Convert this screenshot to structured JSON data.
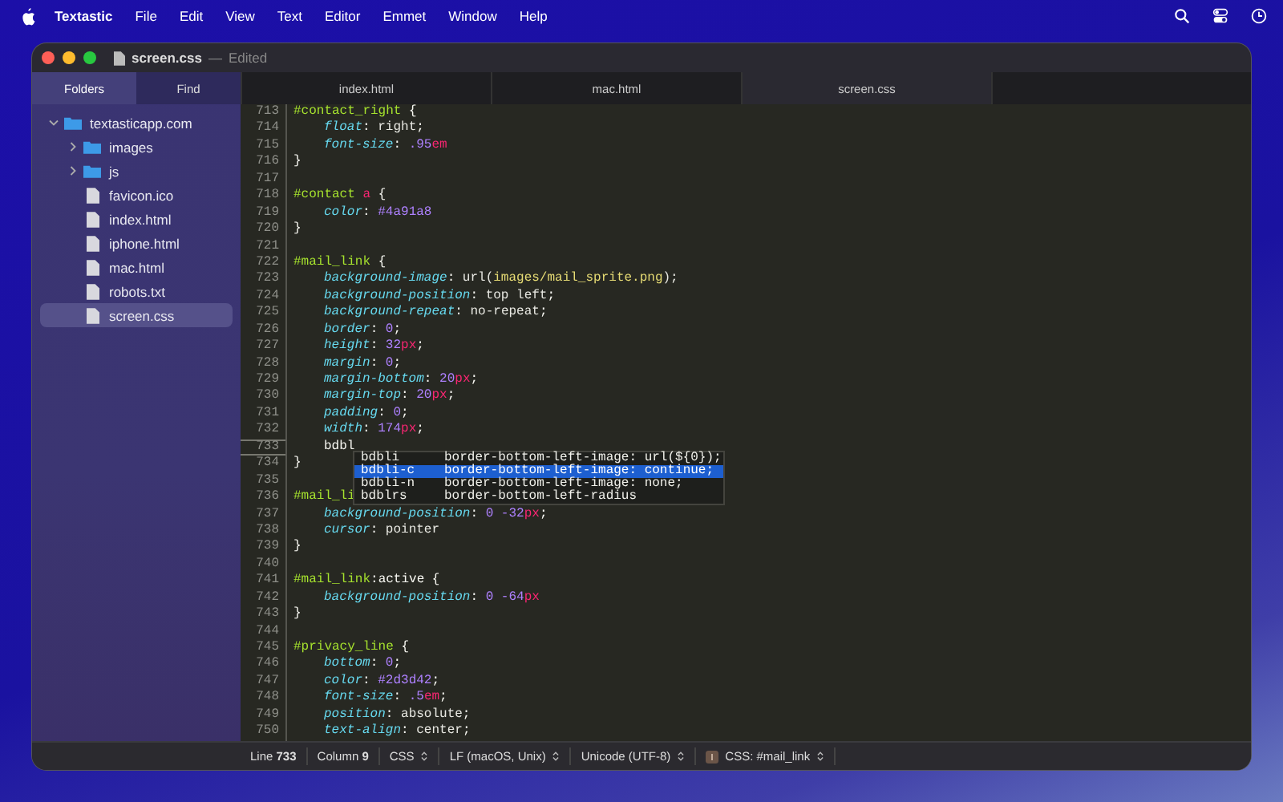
{
  "menubar": {
    "items": [
      {
        "label": "Textastic",
        "kind": "app"
      },
      {
        "label": "File",
        "kind": "menu"
      },
      {
        "label": "Edit",
        "kind": "menu"
      },
      {
        "label": "View",
        "kind": "menu"
      },
      {
        "label": "Text",
        "kind": "menu"
      },
      {
        "label": "Editor",
        "kind": "menu"
      },
      {
        "label": "Emmet",
        "kind": "menu"
      },
      {
        "label": "Window",
        "kind": "menu"
      },
      {
        "label": "Help",
        "kind": "menu"
      }
    ]
  },
  "window": {
    "title": "screen.css",
    "separator": "—",
    "subtitle": "Edited"
  },
  "sidebar": {
    "tabs": [
      {
        "label": "Folders",
        "selected": true
      },
      {
        "label": "Find",
        "selected": false
      }
    ],
    "tree": [
      {
        "name": "textasticapp.com",
        "kind": "folder",
        "expanded": true,
        "selected": false,
        "children": [
          {
            "name": "images",
            "kind": "folder",
            "expanded": false,
            "selected": false
          },
          {
            "name": "js",
            "kind": "folder",
            "expanded": false,
            "selected": false
          },
          {
            "name": "favicon.ico",
            "kind": "file",
            "selected": false
          },
          {
            "name": "index.html",
            "kind": "file",
            "selected": false
          },
          {
            "name": "iphone.html",
            "kind": "file",
            "selected": false
          },
          {
            "name": "mac.html",
            "kind": "file",
            "selected": false
          },
          {
            "name": "robots.txt",
            "kind": "file",
            "selected": false
          },
          {
            "name": "screen.css",
            "kind": "file",
            "selected": true
          }
        ]
      }
    ]
  },
  "tabs": [
    {
      "label": "index.html",
      "selected": false
    },
    {
      "label": "mac.html",
      "selected": false
    },
    {
      "label": "screen.css",
      "selected": true
    }
  ],
  "code": [
    {
      "n": "713",
      "current": false,
      "indent": false,
      "tokens": [
        {
          "kind": "sel",
          "text": "#contact_right"
        },
        {
          "kind": "p",
          "text": " {"
        }
      ]
    },
    {
      "n": "714",
      "current": false,
      "indent": true,
      "tokens": [
        {
          "kind": "prop",
          "text": "float"
        },
        {
          "kind": "p",
          "text": ": "
        },
        {
          "kind": "val",
          "text": "right"
        },
        {
          "kind": "p",
          "text": ";"
        }
      ]
    },
    {
      "n": "715",
      "current": false,
      "indent": true,
      "tokens": [
        {
          "kind": "prop",
          "text": "font-size"
        },
        {
          "kind": "p",
          "text": ": "
        },
        {
          "kind": "num",
          "text": ".95"
        },
        {
          "kind": "unit",
          "text": "em"
        }
      ]
    },
    {
      "n": "716",
      "current": false,
      "indent": false,
      "tokens": [
        {
          "kind": "p",
          "text": "}"
        }
      ]
    },
    {
      "n": "717",
      "current": false
    },
    {
      "n": "718",
      "current": false,
      "indent": false,
      "tokens": [
        {
          "kind": "sel",
          "text": "#contact"
        },
        {
          "kind": "unit",
          "text": " a"
        },
        {
          "kind": "p",
          "text": " {"
        }
      ]
    },
    {
      "n": "719",
      "current": false,
      "indent": true,
      "tokens": [
        {
          "kind": "prop",
          "text": "color"
        },
        {
          "kind": "p",
          "text": ": "
        },
        {
          "kind": "num",
          "text": "#4a91a8"
        }
      ]
    },
    {
      "n": "720",
      "current": false,
      "indent": false,
      "tokens": [
        {
          "kind": "p",
          "text": "}"
        }
      ]
    },
    {
      "n": "721",
      "current": false
    },
    {
      "n": "722",
      "current": false,
      "indent": false,
      "tokens": [
        {
          "kind": "sel",
          "text": "#mail_link"
        },
        {
          "kind": "p",
          "text": " {"
        }
      ]
    },
    {
      "n": "723",
      "current": false,
      "indent": true,
      "tokens": [
        {
          "kind": "prop",
          "text": "background-image"
        },
        {
          "kind": "p",
          "text": ": "
        },
        {
          "kind": "val",
          "text": "url("
        },
        {
          "kind": "str",
          "text": "images/mail_sprite.png"
        },
        {
          "kind": "val",
          "text": ");"
        }
      ]
    },
    {
      "n": "724",
      "current": false,
      "indent": true,
      "tokens": [
        {
          "kind": "prop",
          "text": "background-position"
        },
        {
          "kind": "p",
          "text": ": "
        },
        {
          "kind": "val",
          "text": "top left"
        },
        {
          "kind": "p",
          "text": ";"
        }
      ]
    },
    {
      "n": "725",
      "current": false,
      "indent": true,
      "tokens": [
        {
          "kind": "prop",
          "text": "background-repeat"
        },
        {
          "kind": "p",
          "text": ": "
        },
        {
          "kind": "val",
          "text": "no-repeat"
        },
        {
          "kind": "p",
          "text": ";"
        }
      ]
    },
    {
      "n": "726",
      "current": false,
      "indent": true,
      "tokens": [
        {
          "kind": "prop",
          "text": "border"
        },
        {
          "kind": "p",
          "text": ": "
        },
        {
          "kind": "num",
          "text": "0"
        },
        {
          "kind": "p",
          "text": ";"
        }
      ]
    },
    {
      "n": "727",
      "current": false,
      "indent": true,
      "tokens": [
        {
          "kind": "prop",
          "text": "height"
        },
        {
          "kind": "p",
          "text": ": "
        },
        {
          "kind": "num",
          "text": "32"
        },
        {
          "kind": "unit",
          "text": "px"
        },
        {
          "kind": "p",
          "text": ";"
        }
      ]
    },
    {
      "n": "728",
      "current": false,
      "indent": true,
      "tokens": [
        {
          "kind": "prop",
          "text": "margin"
        },
        {
          "kind": "p",
          "text": ": "
        },
        {
          "kind": "num",
          "text": "0"
        },
        {
          "kind": "p",
          "text": ";"
        }
      ]
    },
    {
      "n": "729",
      "current": false,
      "indent": true,
      "tokens": [
        {
          "kind": "prop",
          "text": "margin-bottom"
        },
        {
          "kind": "p",
          "text": ": "
        },
        {
          "kind": "num",
          "text": "20"
        },
        {
          "kind": "unit",
          "text": "px"
        },
        {
          "kind": "p",
          "text": ";"
        }
      ]
    },
    {
      "n": "730",
      "current": false,
      "indent": true,
      "tokens": [
        {
          "kind": "prop",
          "text": "margin-top"
        },
        {
          "kind": "p",
          "text": ": "
        },
        {
          "kind": "num",
          "text": "20"
        },
        {
          "kind": "unit",
          "text": "px"
        },
        {
          "kind": "p",
          "text": ";"
        }
      ]
    },
    {
      "n": "731",
      "current": false,
      "indent": true,
      "tokens": [
        {
          "kind": "prop",
          "text": "padding"
        },
        {
          "kind": "p",
          "text": ": "
        },
        {
          "kind": "num",
          "text": "0"
        },
        {
          "kind": "p",
          "text": ";"
        }
      ]
    },
    {
      "n": "732",
      "current": false,
      "indent": true,
      "tokens": [
        {
          "kind": "prop",
          "text": "width"
        },
        {
          "kind": "p",
          "text": ": "
        },
        {
          "kind": "num",
          "text": "174"
        },
        {
          "kind": "unit",
          "text": "px"
        },
        {
          "kind": "p",
          "text": ";"
        }
      ]
    },
    {
      "n": "733",
      "current": true,
      "indent": true,
      "tokens": [
        {
          "kind": "p",
          "text": "bdbl"
        }
      ]
    },
    {
      "n": "734",
      "current": false,
      "indent": false,
      "tokens": [
        {
          "kind": "p",
          "text": "}"
        }
      ]
    },
    {
      "n": "735",
      "current": false
    },
    {
      "n": "736",
      "current": false,
      "indent": false,
      "tokens": [
        {
          "kind": "sel",
          "text": "#mail_li"
        }
      ]
    },
    {
      "n": "737",
      "current": false,
      "indent": true,
      "tokens": [
        {
          "kind": "prop",
          "text": "background-position"
        },
        {
          "kind": "p",
          "text": ": "
        },
        {
          "kind": "num",
          "text": "0 -32"
        },
        {
          "kind": "unit",
          "text": "px"
        },
        {
          "kind": "p",
          "text": ";"
        }
      ]
    },
    {
      "n": "738",
      "current": false,
      "indent": true,
      "tokens": [
        {
          "kind": "prop",
          "text": "cursor"
        },
        {
          "kind": "p",
          "text": ": "
        },
        {
          "kind": "val",
          "text": "pointer"
        }
      ]
    },
    {
      "n": "739",
      "current": false,
      "indent": false,
      "tokens": [
        {
          "kind": "p",
          "text": "}"
        }
      ]
    },
    {
      "n": "740",
      "current": false
    },
    {
      "n": "741",
      "current": false,
      "indent": false,
      "tokens": [
        {
          "kind": "sel",
          "text": "#mail_link"
        },
        {
          "kind": "p",
          "text": ":active {"
        }
      ]
    },
    {
      "n": "742",
      "current": false,
      "indent": true,
      "tokens": [
        {
          "kind": "prop",
          "text": "background-position"
        },
        {
          "kind": "p",
          "text": ": "
        },
        {
          "kind": "num",
          "text": "0 -64"
        },
        {
          "kind": "unit",
          "text": "px"
        }
      ]
    },
    {
      "n": "743",
      "current": false,
      "indent": false,
      "tokens": [
        {
          "kind": "p",
          "text": "}"
        }
      ]
    },
    {
      "n": "744",
      "current": false
    },
    {
      "n": "745",
      "current": false,
      "indent": false,
      "tokens": [
        {
          "kind": "sel",
          "text": "#privacy_line"
        },
        {
          "kind": "p",
          "text": " {"
        }
      ]
    },
    {
      "n": "746",
      "current": false,
      "indent": true,
      "tokens": [
        {
          "kind": "prop",
          "text": "bottom"
        },
        {
          "kind": "p",
          "text": ": "
        },
        {
          "kind": "num",
          "text": "0"
        },
        {
          "kind": "p",
          "text": ";"
        }
      ]
    },
    {
      "n": "747",
      "current": false,
      "indent": true,
      "tokens": [
        {
          "kind": "prop",
          "text": "color"
        },
        {
          "kind": "p",
          "text": ": "
        },
        {
          "kind": "num",
          "text": "#2d3d42"
        },
        {
          "kind": "p",
          "text": ";"
        }
      ]
    },
    {
      "n": "748",
      "current": false,
      "indent": true,
      "tokens": [
        {
          "kind": "prop",
          "text": "font-size"
        },
        {
          "kind": "p",
          "text": ": "
        },
        {
          "kind": "num",
          "text": ".5"
        },
        {
          "kind": "unit",
          "text": "em"
        },
        {
          "kind": "p",
          "text": ";"
        }
      ]
    },
    {
      "n": "749",
      "current": false,
      "indent": true,
      "tokens": [
        {
          "kind": "prop",
          "text": "position"
        },
        {
          "kind": "p",
          "text": ": "
        },
        {
          "kind": "val",
          "text": "absolute"
        },
        {
          "kind": "p",
          "text": ";"
        }
      ]
    },
    {
      "n": "750",
      "current": false,
      "indent": true,
      "tokens": [
        {
          "kind": "prop",
          "text": "text-align"
        },
        {
          "kind": "p",
          "text": ": "
        },
        {
          "kind": "val",
          "text": "center"
        },
        {
          "kind": "p",
          "text": ";"
        }
      ]
    }
  ],
  "completions": [
    {
      "abbr": "bdbli",
      "expansion": "border-bottom-left-image: url(${0});",
      "selected": false
    },
    {
      "abbr": "bdbli-c",
      "expansion": "border-bottom-left-image: continue;",
      "selected": true
    },
    {
      "abbr": "bdbli-n",
      "expansion": "border-bottom-left-image: none;",
      "selected": false
    },
    {
      "abbr": "bdblrs",
      "expansion": "border-bottom-left-radius",
      "selected": false
    }
  ],
  "status_bar": [
    {
      "text": "Line **733**",
      "kind": "text"
    },
    {
      "text": "Column **9**",
      "kind": "text"
    },
    {
      "text": "CSS",
      "kind": "menu"
    },
    {
      "text": "LF (macOS, Unix)",
      "kind": "menu"
    },
    {
      "text": "Unicode (UTF-8)",
      "kind": "menu"
    },
    {
      "text": "CSS: #mail_link",
      "kind": "symbol"
    }
  ]
}
